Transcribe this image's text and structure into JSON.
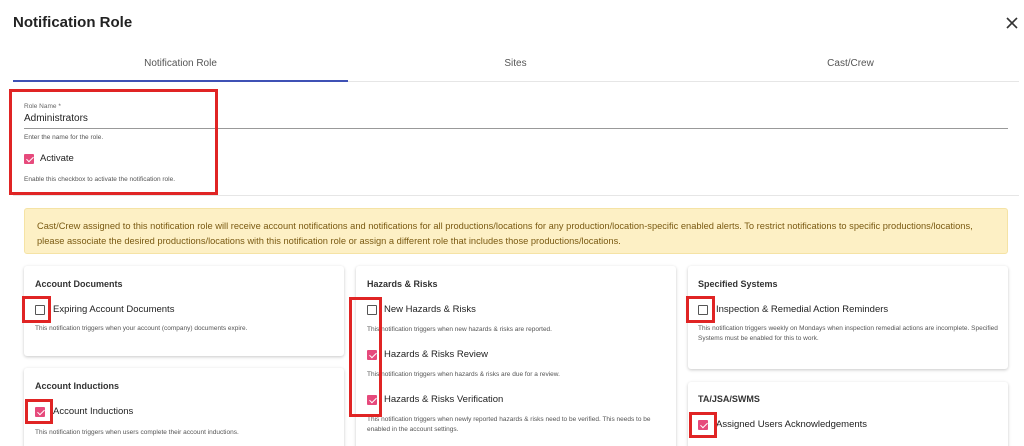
{
  "dialog": {
    "title": "Notification Role",
    "close_icon": "close-icon"
  },
  "tabs": [
    {
      "label": "Notification Role",
      "active": true
    },
    {
      "label": "Sites",
      "active": false
    },
    {
      "label": "Cast/Crew",
      "active": false
    }
  ],
  "role": {
    "name_label": "Role Name *",
    "name_value": "Administrators",
    "name_hint": "Enter the name for the role.",
    "activate_label": "Activate",
    "activate_checked": true,
    "activate_hint": "Enable this checkbox to activate the notification role."
  },
  "banner": {
    "text": "Cast/Crew assigned to this notification role will receive account notifications and notifications for all productions/locations for any production/location-specific enabled alerts. To restrict notifications to specific productions/locations, please associate the desired productions/locations with this notification role or assign a different role that includes those productions/locations."
  },
  "cards": {
    "account_documents": {
      "title": "Account Documents",
      "items": [
        {
          "label": "Expiring Account Documents",
          "checked": false,
          "desc": "This notification triggers when your account (company) documents expire."
        }
      ]
    },
    "account_inductions": {
      "title": "Account Inductions",
      "items": [
        {
          "label": "Account Inductions",
          "checked": true,
          "desc": "This notification triggers when users complete their account inductions."
        }
      ]
    },
    "hazards_risks": {
      "title": "Hazards & Risks",
      "items": [
        {
          "label": "New Hazards & Risks",
          "checked": false,
          "desc": "This notification triggers when new hazards & risks are reported."
        },
        {
          "label": "Hazards & Risks Review",
          "checked": true,
          "desc": "This notification triggers when hazards & risks are due for a review."
        },
        {
          "label": "Hazards & Risks Verification",
          "checked": true,
          "desc": "This notification triggers when newly reported hazards & risks need to be verified. This needs to be enabled in the account settings."
        }
      ]
    },
    "specified_systems": {
      "title": "Specified Systems",
      "items": [
        {
          "label": "Inspection & Remedial Action Reminders",
          "checked": false,
          "desc": "This notification triggers weekly on Mondays when inspection remedial actions are incomplete. Specified Systems must be enabled for this to work."
        }
      ]
    },
    "ta_jsa_swms": {
      "title": "TA/JSA/SWMS",
      "items": [
        {
          "label": "Assigned Users Acknowledgements",
          "checked": true
        }
      ]
    }
  },
  "colors": {
    "accent": "#3f51b5",
    "checkbox_checked": "#e64a7c",
    "highlight_red": "#e02424",
    "banner_bg": "#fdf0c5",
    "banner_text": "#7a5a12"
  }
}
